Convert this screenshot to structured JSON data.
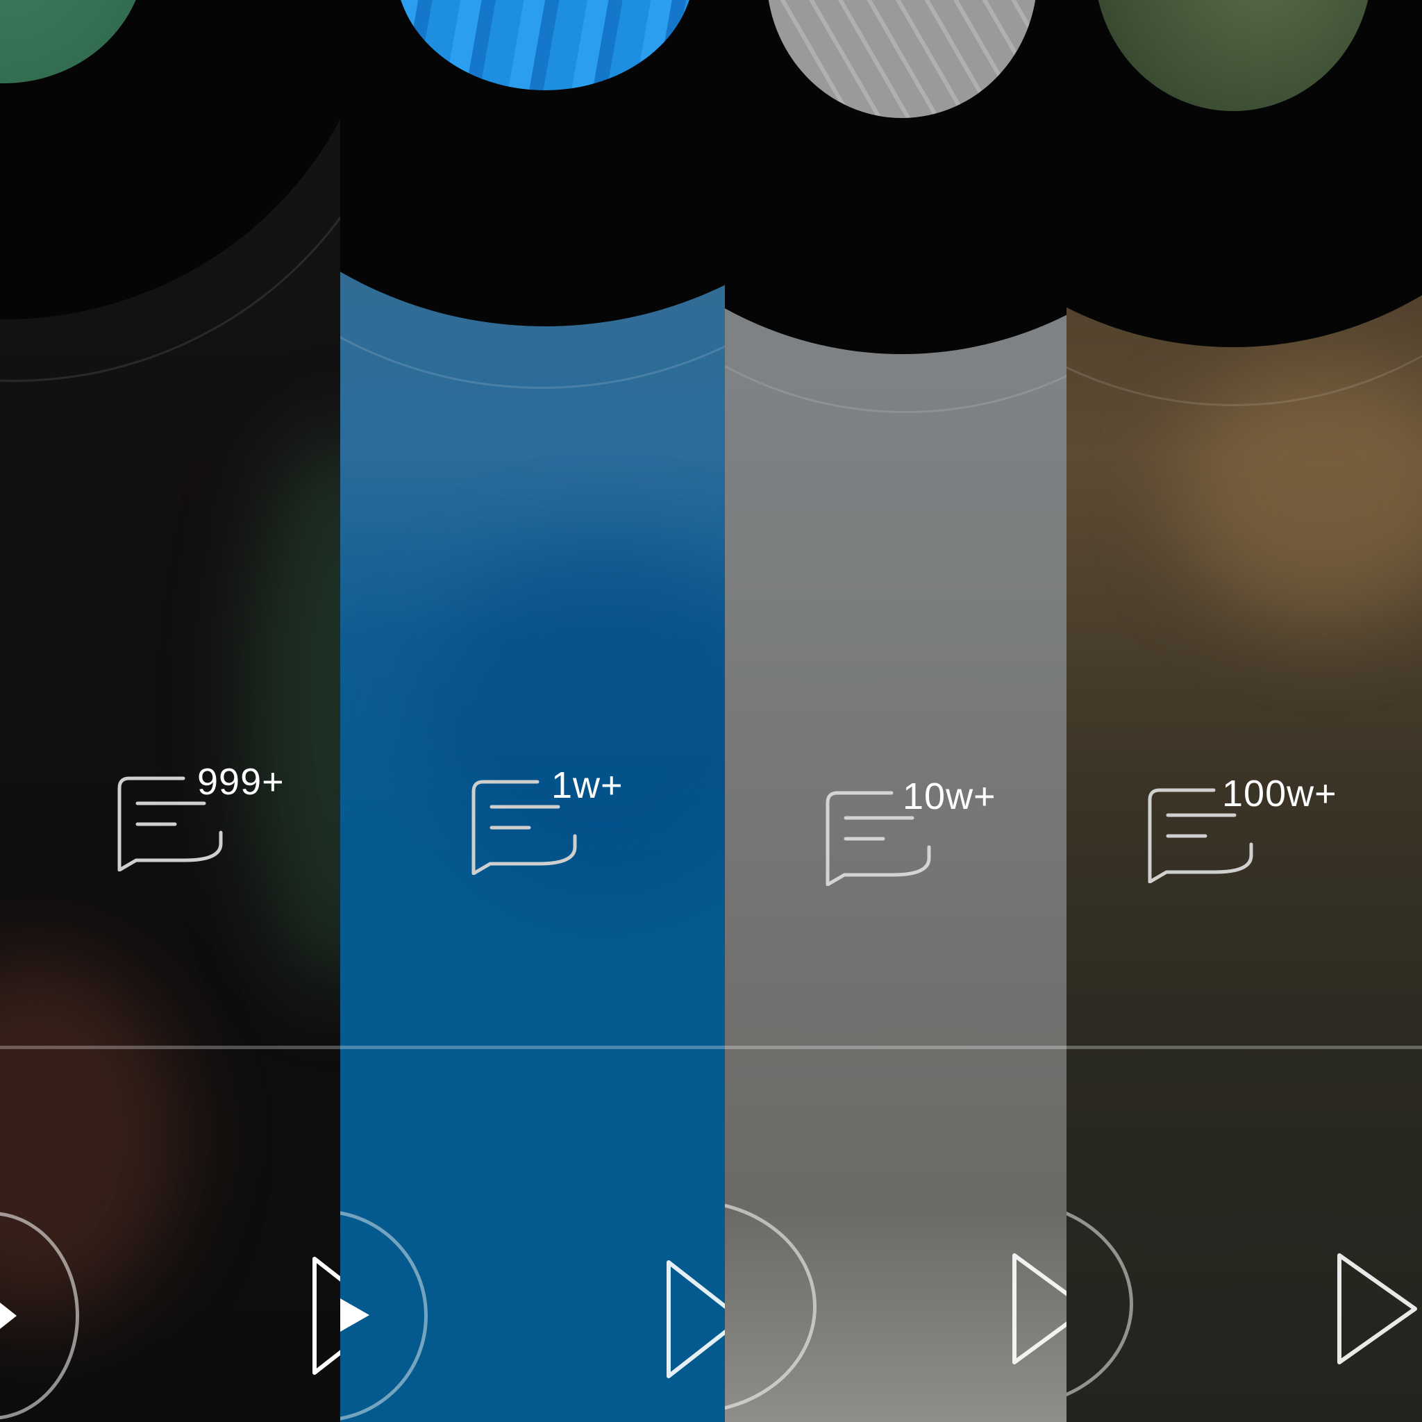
{
  "panels": [
    {
      "id": "p1",
      "comment_count": "999+"
    },
    {
      "id": "p2",
      "comment_count": "1w+"
    },
    {
      "id": "p3",
      "comment_count": "10w+"
    },
    {
      "id": "p4",
      "comment_count": "100w+"
    }
  ],
  "icons": {
    "comment": "comment-bubble-icon",
    "play": "play-icon",
    "next": "next-track-icon"
  },
  "colors": {
    "panel_1_bg": "#120f0f",
    "panel_2_bg": "#065a8f",
    "panel_3_bg": "#737372",
    "panel_4_bg": "#2a2921",
    "icon_stroke": "#cfcfcf",
    "text": "#ffffff"
  }
}
